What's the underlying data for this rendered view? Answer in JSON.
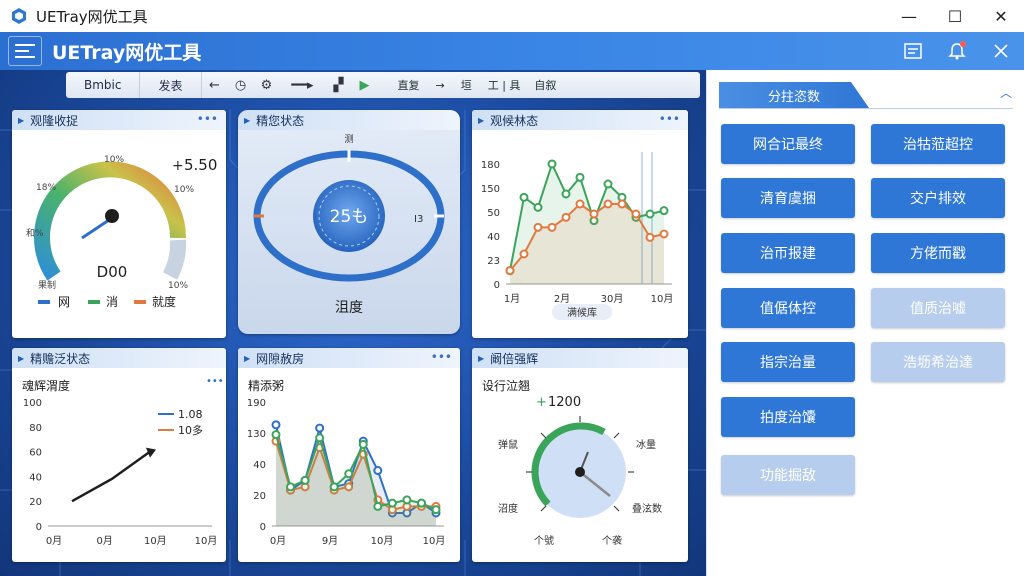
{
  "window": {
    "title": "UETray网优工具",
    "controls": [
      "—",
      "☐",
      "✕"
    ]
  },
  "app": {
    "title": "UETray网优工具",
    "header_icons": [
      "list-check-icon",
      "bell-icon",
      "collapse-icon"
    ]
  },
  "toolbar": {
    "tabs": [
      "Bmbic",
      "发表"
    ],
    "icons": [
      "back-arrow-icon",
      "clock-icon",
      "gear-icon",
      "line-icon",
      "grid-icon",
      "play-icon"
    ],
    "right_items": [
      "直复",
      "→",
      "垣",
      "工 | 具",
      "自叙"
    ]
  },
  "panels": {
    "gauge1": {
      "title": "观隆收捉",
      "value": "5.50",
      "center_label": "D00",
      "ticks": [
        "10%",
        "18%",
        "10%",
        "和%",
        "10%",
        "果制"
      ],
      "legend": [
        "网",
        "消",
        "就度"
      ],
      "legend_colors": [
        "#2e6fc9",
        "#3aa55a",
        "#e07a40"
      ]
    },
    "ring": {
      "title": "精您状态",
      "top_label": "测",
      "center_value": "25も",
      "right_label": "I3",
      "bottom_label": "沮度"
    },
    "chart1": {
      "title": "观候林态",
      "y_ticks": [
        "180",
        "150",
        "50",
        "40",
        "23",
        "0"
      ],
      "x_ticks": [
        "1月",
        "2月",
        "30月",
        "10月"
      ],
      "x_label": "满候库"
    },
    "line2": {
      "title": "精赡泛状态",
      "subtitle": "魂辉渭度",
      "y_ticks": [
        "100",
        "80",
        "60",
        "40",
        "20",
        "0"
      ],
      "x_ticks": [
        "0月",
        "0月",
        "10月",
        "10月"
      ],
      "legend": [
        "1.08",
        "10多"
      ]
    },
    "chart3": {
      "title": "网隙赦房",
      "subtitle": "精添粥",
      "y_ticks": [
        "190",
        "130",
        "40",
        "20",
        "0"
      ],
      "x_ticks": [
        "0月",
        "9月",
        "10月",
        "10月"
      ]
    },
    "gauge2": {
      "title": "阚倍强辉",
      "subtitle": "设行泣翘",
      "value": "1200",
      "labels": [
        "弹鼠",
        "冰量",
        "沼度",
        "叠泫数",
        "个號",
        "个袭"
      ]
    }
  },
  "chart_data": [
    {
      "type": "area",
      "title": "观候林态",
      "categories": [
        "1月",
        "2月",
        "30月",
        "10月"
      ],
      "xlabel": "满候库",
      "ylim": [
        0,
        180
      ],
      "series": [
        {
          "color": "#3aa55a",
          "values": [
            20,
            130,
            115,
            180,
            135,
            160,
            95,
            150,
            130,
            100,
            105,
            110
          ]
        },
        {
          "color": "#e07a40",
          "values": [
            20,
            45,
            85,
            85,
            100,
            120,
            105,
            120,
            120,
            105,
            70,
            75
          ]
        }
      ]
    },
    {
      "type": "line",
      "title": "魂辉渭度",
      "categories": [
        "0月",
        "0月",
        "10月",
        "10月"
      ],
      "ylim": [
        0,
        100
      ],
      "series": [
        {
          "name": "1.08",
          "color": "#1e1e1e",
          "values": [
            20,
            38,
            60
          ]
        }
      ]
    },
    {
      "type": "area",
      "title": "精添粥",
      "categories": [
        "0月",
        "9月",
        "10月",
        "10月"
      ],
      "ylim": [
        0,
        190
      ],
      "series": [
        {
          "color": "#2e6fc9",
          "values": [
            155,
            55,
            70,
            150,
            60,
            65,
            130,
            85,
            20,
            20,
            35,
            20
          ]
        },
        {
          "color": "#e07a40",
          "values": [
            130,
            55,
            60,
            120,
            55,
            60,
            110,
            40,
            25,
            30,
            30,
            30
          ]
        },
        {
          "color": "#3aa55a",
          "values": [
            140,
            60,
            70,
            135,
            60,
            80,
            125,
            30,
            35,
            40,
            35,
            25
          ]
        }
      ]
    }
  ],
  "side": {
    "header": "分拄恣数",
    "collapse_icon": "chevron-up-icon",
    "buttons": [
      {
        "label": "网合记最终",
        "enabled": true
      },
      {
        "label": "治牯蒞超控",
        "enabled": true
      },
      {
        "label": "清育虞捆",
        "enabled": true
      },
      {
        "label": "交户排效",
        "enabled": true
      },
      {
        "label": "治帀报建",
        "enabled": true
      },
      {
        "label": "方佬而戳",
        "enabled": true
      },
      {
        "label": "值倨体控",
        "enabled": true
      },
      {
        "label": "值质治嘘",
        "enabled": false
      },
      {
        "label": "指宗治量",
        "enabled": true
      },
      {
        "label": "浩坜希治達",
        "enabled": false
      },
      {
        "label": "拍度治馕",
        "enabled": true
      },
      {
        "label": "功能掘敌",
        "enabled": false
      }
    ]
  },
  "colors": {
    "accent": "#2f77d6",
    "disabled": "#b6cdee",
    "green": "#3aa55a",
    "orange": "#e07a40",
    "blue": "#2e6fc9"
  }
}
